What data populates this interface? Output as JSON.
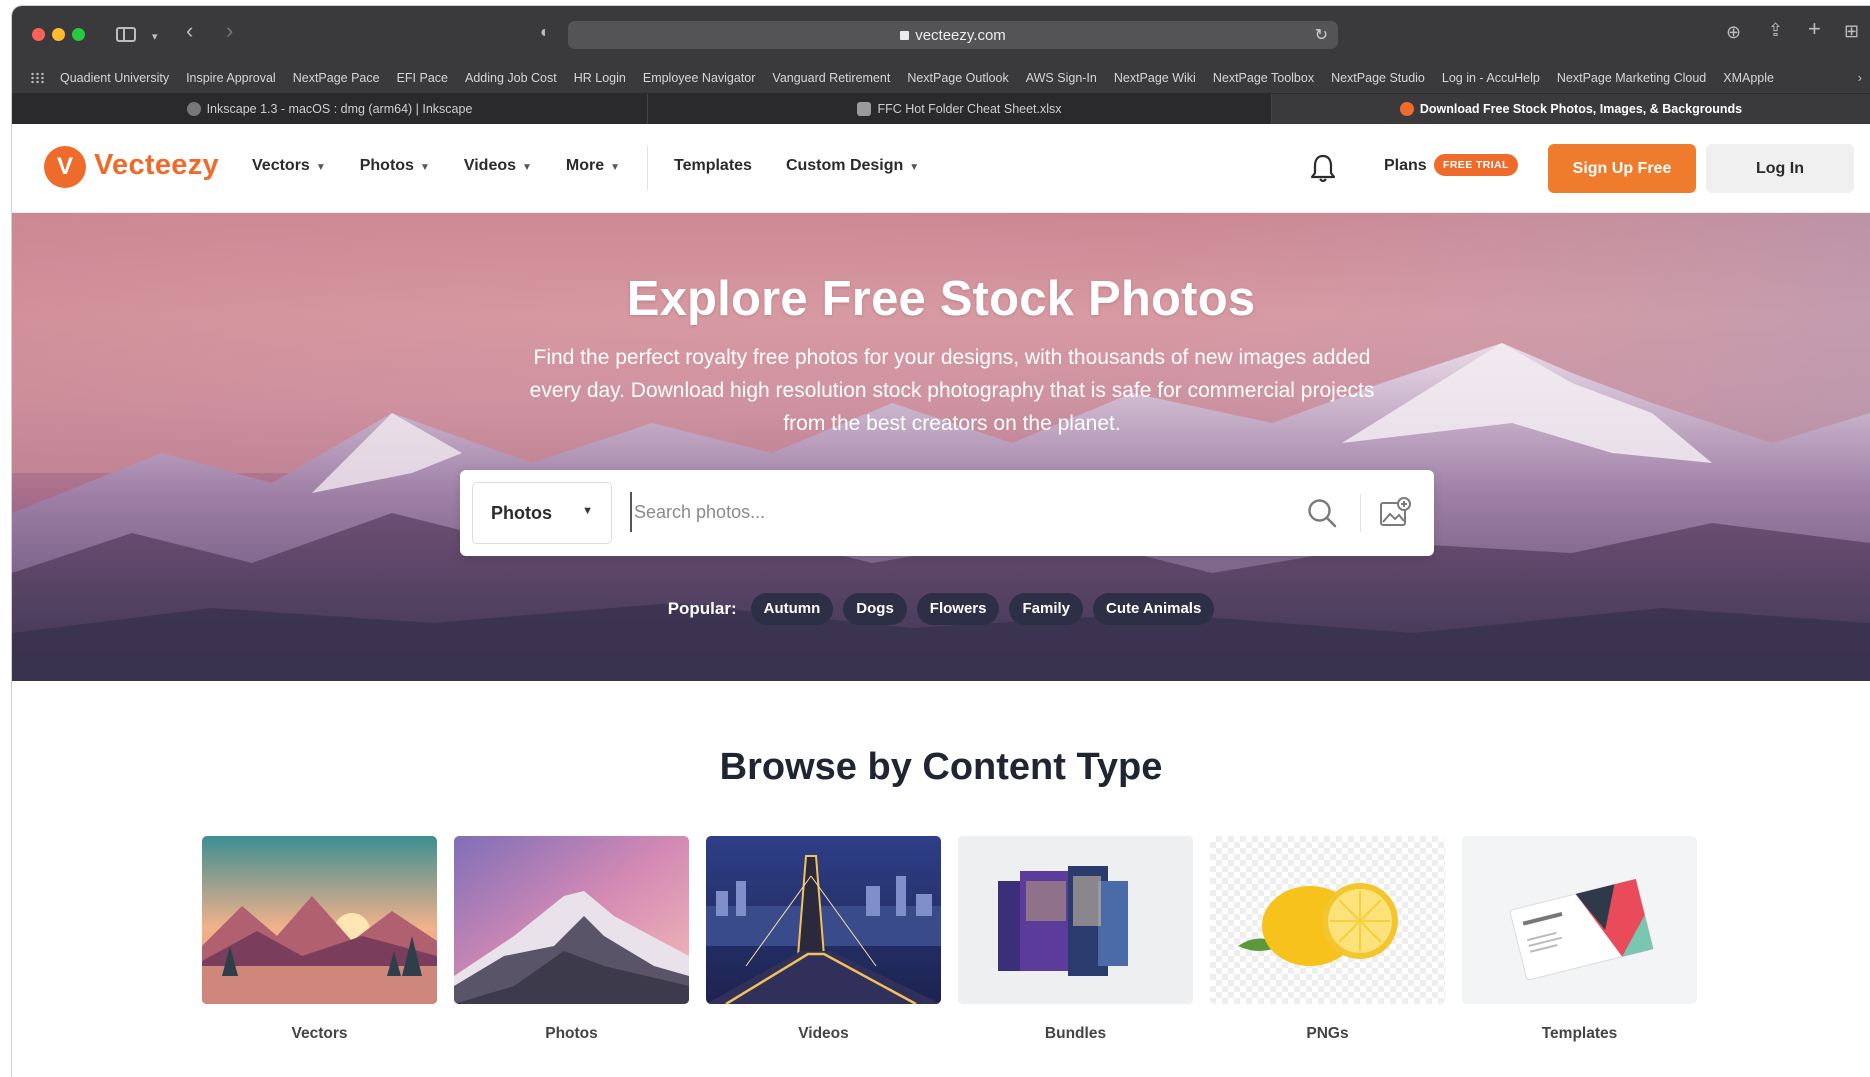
{
  "browser": {
    "url": "vecteezy.com",
    "bookmarks": [
      "Quadient University",
      "Inspire Approval",
      "NextPage Pace",
      "EFI Pace",
      "Adding Job Cost",
      "HR Login",
      "Employee Navigator",
      "Vanguard Retirement",
      "NextPage Outlook",
      "AWS Sign-In",
      "NextPage Wiki",
      "NextPage Toolbox",
      "NextPage Studio",
      "Log in - AccuHelp",
      "NextPage Marketing Cloud",
      "XMApple"
    ],
    "tabs": [
      {
        "label": "Inkscape 1.3 - macOS : dmg (arm64) | Inkscape",
        "active": false
      },
      {
        "label": "FFC Hot Folder Cheat Sheet.xlsx",
        "active": false
      },
      {
        "label": "Download Free Stock Photos, Images, & Backgrounds",
        "active": true
      }
    ]
  },
  "header": {
    "logo": "Vecteezy",
    "nav": [
      "Vectors",
      "Photos",
      "Videos",
      "More"
    ],
    "nav2": {
      "templates": "Templates",
      "custom_design": "Custom Design"
    },
    "plans": "Plans",
    "free_trial": "FREE TRIAL",
    "signup": "Sign Up Free",
    "login": "Log In"
  },
  "hero": {
    "title": "Explore Free Stock Photos",
    "subtitle": "Find the perfect royalty free photos for your designs, with thousands of new images added every day. Download high resolution stock photography that is safe for commercial projects from the best creators on the planet.",
    "search": {
      "type": "Photos",
      "placeholder": "Search photos..."
    },
    "popular_label": "Popular:",
    "popular": [
      "Autumn",
      "Dogs",
      "Flowers",
      "Family",
      "Cute Animals"
    ]
  },
  "browse": {
    "title": "Browse by Content Type",
    "cards": [
      "Vectors",
      "Photos",
      "Videos",
      "Bundles",
      "PNGs",
      "Templates"
    ]
  },
  "colors": {
    "brand": "#ef6b2c",
    "dark_chip": "#2c2f45",
    "heading": "#1f2533"
  }
}
